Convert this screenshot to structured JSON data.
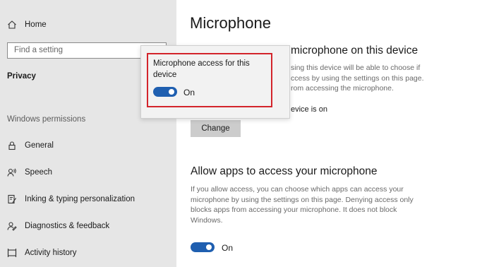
{
  "sidebar": {
    "home_label": "Home",
    "search_placeholder": "Find a setting",
    "section_title": "Privacy",
    "group_label": "Windows permissions",
    "items": [
      {
        "label": "General",
        "icon": "lock-icon"
      },
      {
        "label": "Speech",
        "icon": "speech-icon"
      },
      {
        "label": "Inking & typing personalization",
        "icon": "inking-icon"
      },
      {
        "label": "Diagnostics & feedback",
        "icon": "diagnostics-icon"
      },
      {
        "label": "Activity history",
        "icon": "activity-history-icon"
      }
    ]
  },
  "main": {
    "page_title": "Microphone",
    "device_section": {
      "heading_visible": "microphone on this device",
      "desc_lines": [
        "sing this device will be able to choose if",
        "ccess by using the settings on this page.",
        "rom accessing the microphone."
      ],
      "status_visible": "evice is on",
      "change_label": "Change"
    },
    "apps_section": {
      "heading": "Allow apps to access your microphone",
      "desc_lines": [
        "If you allow access, you can choose which apps can access your",
        "microphone by using the settings on this page. Denying access only",
        "blocks apps from accessing your microphone. It does not block",
        "Windows."
      ],
      "toggle_state": "On",
      "toggle_on": true
    }
  },
  "popup": {
    "title": "Microphone access for this device",
    "toggle_state": "On",
    "toggle_on": true
  },
  "colors": {
    "sidebar_bg": "#e6e6e6",
    "accent": "#1f5fb0",
    "highlight": "#d3242b",
    "button_bg": "#cccccc"
  }
}
